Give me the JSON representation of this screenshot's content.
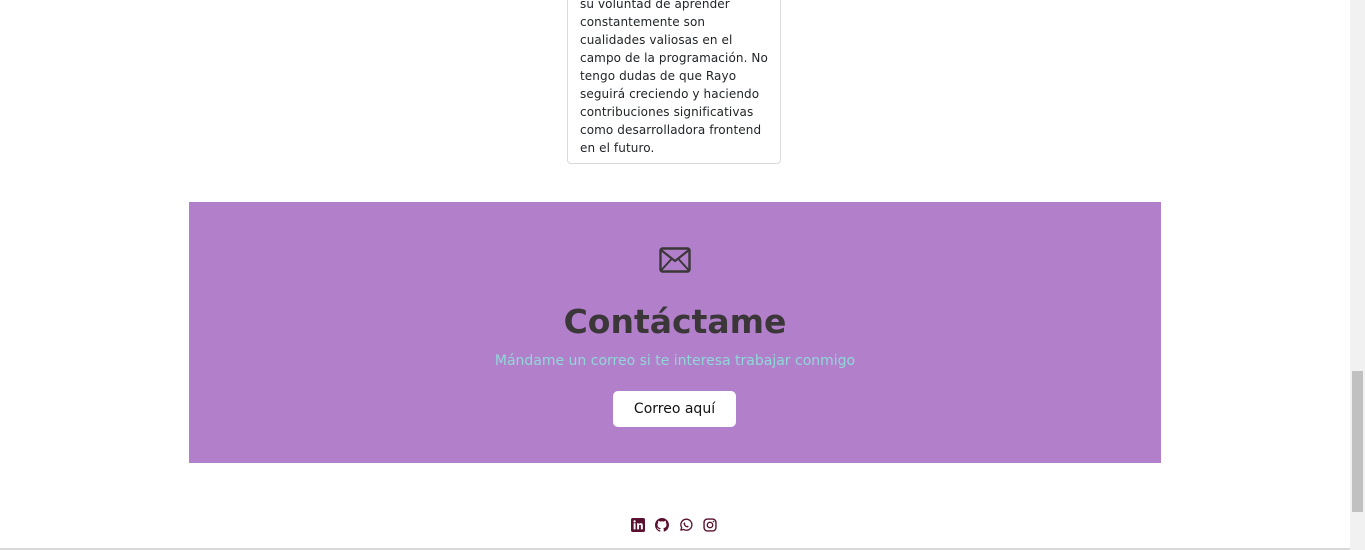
{
  "testimonial": {
    "text": "su voluntad de aprender constantemente son cualidades valiosas en el campo de la programación. No tengo dudas de que Rayo seguirá creciendo y haciendo contribuciones significativas como desarrolladora frontend en el futuro."
  },
  "contact": {
    "icon": "envelope-icon",
    "title": "Contáctame",
    "subtitle": "Mándame un correo si te interesa trabajar conmigo",
    "button_label": "Correo aquí",
    "background_color": "#b280cb",
    "title_color": "#3b3638",
    "subtitle_color": "#8fd8d8"
  },
  "footer": {
    "social_icons": [
      "linkedin-icon",
      "github-icon",
      "whatsapp-icon",
      "instagram-icon"
    ],
    "icon_color": "#5a1030"
  }
}
